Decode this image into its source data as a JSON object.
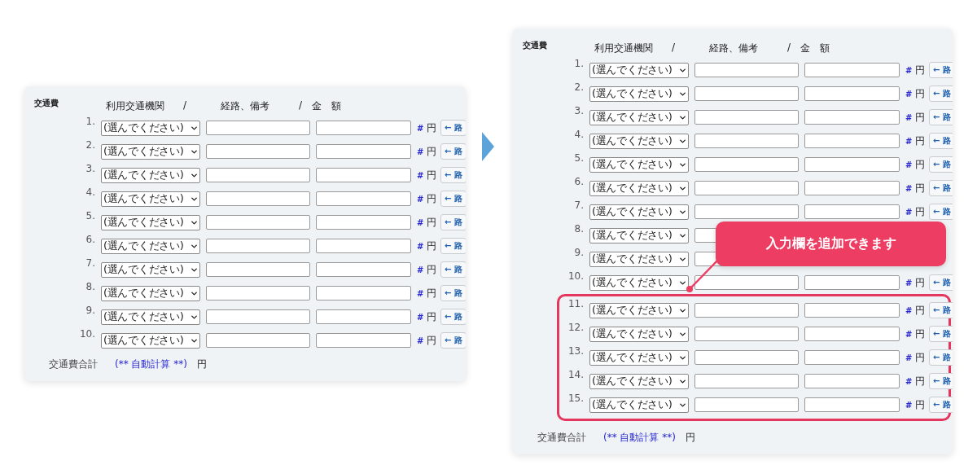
{
  "panels": [
    {
      "title": "交通費",
      "headers": [
        "利用交通機関",
        "/",
        "経路、備考",
        "/",
        "金　額"
      ],
      "rows": [
        {
          "number": "1.",
          "select": "(選んでください)",
          "hash": "#",
          "unit": "円",
          "button": "← 路",
          "highlighted": false
        },
        {
          "number": "2.",
          "select": "(選んでください)",
          "hash": "#",
          "unit": "円",
          "button": "← 路",
          "highlighted": false
        },
        {
          "number": "3.",
          "select": "(選んでください)",
          "hash": "#",
          "unit": "円",
          "button": "← 路",
          "highlighted": false
        },
        {
          "number": "4.",
          "select": "(選んでください)",
          "hash": "#",
          "unit": "円",
          "button": "← 路",
          "highlighted": false
        },
        {
          "number": "5.",
          "select": "(選んでください)",
          "hash": "#",
          "unit": "円",
          "button": "← 路",
          "highlighted": false
        },
        {
          "number": "6.",
          "select": "(選んでください)",
          "hash": "#",
          "unit": "円",
          "button": "← 路",
          "highlighted": false
        },
        {
          "number": "7.",
          "select": "(選んでください)",
          "hash": "#",
          "unit": "円",
          "button": "← 路",
          "highlighted": false
        },
        {
          "number": "8.",
          "select": "(選んでください)",
          "hash": "#",
          "unit": "円",
          "button": "← 路",
          "highlighted": false
        },
        {
          "number": "9.",
          "select": "(選んでください)",
          "hash": "#",
          "unit": "円",
          "button": "← 路",
          "highlighted": false
        },
        {
          "number": "10.",
          "select": "(選んでください)",
          "hash": "#",
          "unit": "円",
          "button": "← 路",
          "highlighted": false
        }
      ],
      "total": {
        "label": "交通費合計",
        "value": "(** 自動計算 **)",
        "unit": "円"
      }
    },
    {
      "title": "交通費",
      "headers": [
        "利用交通機関",
        "/",
        "経路、備考",
        "/",
        "金　額"
      ],
      "rows": [
        {
          "number": "1.",
          "select": "(選んでください)",
          "hash": "#",
          "unit": "円",
          "button": "← 路",
          "highlighted": false
        },
        {
          "number": "2.",
          "select": "(選んでください)",
          "hash": "#",
          "unit": "円",
          "button": "← 路",
          "highlighted": false
        },
        {
          "number": "3.",
          "select": "(選んでください)",
          "hash": "#",
          "unit": "円",
          "button": "← 路",
          "highlighted": false
        },
        {
          "number": "4.",
          "select": "(選んでください)",
          "hash": "#",
          "unit": "円",
          "button": "← 路",
          "highlighted": false
        },
        {
          "number": "5.",
          "select": "(選んでください)",
          "hash": "#",
          "unit": "円",
          "button": "← 路",
          "highlighted": false
        },
        {
          "number": "6.",
          "select": "(選んでください)",
          "hash": "#",
          "unit": "円",
          "button": "← 路",
          "highlighted": false
        },
        {
          "number": "7.",
          "select": "(選んでください)",
          "hash": "#",
          "unit": "円",
          "button": "← 路",
          "highlighted": false
        },
        {
          "number": "8.",
          "select": "(選んでください)",
          "highlighted": false
        },
        {
          "number": "9.",
          "select": "(選んでください)",
          "highlighted": false
        },
        {
          "number": "10.",
          "select": "(選んでください)",
          "hash": "#",
          "unit": "円",
          "button": "← 路",
          "highlighted": false
        },
        {
          "number": "11.",
          "select": "(選んでください)",
          "hash": "#",
          "unit": "円",
          "button": "← 路",
          "highlighted": true
        },
        {
          "number": "12.",
          "select": "(選んでください)",
          "hash": "#",
          "unit": "円",
          "button": "← 路",
          "highlighted": true
        },
        {
          "number": "13.",
          "select": "(選んでください)",
          "hash": "#",
          "unit": "円",
          "button": "← 路",
          "highlighted": true
        },
        {
          "number": "14.",
          "select": "(選んでください)",
          "hash": "#",
          "unit": "円",
          "button": "← 路",
          "highlighted": true
        },
        {
          "number": "15.",
          "select": "(選んでください)",
          "hash": "#",
          "unit": "円",
          "button": "← 路",
          "highlighted": true
        }
      ],
      "total": {
        "label": "交通費合計",
        "value": "(** 自動計算 **)",
        "unit": "円"
      },
      "callout": {
        "text": "入力欄を追加できます"
      }
    }
  ]
}
